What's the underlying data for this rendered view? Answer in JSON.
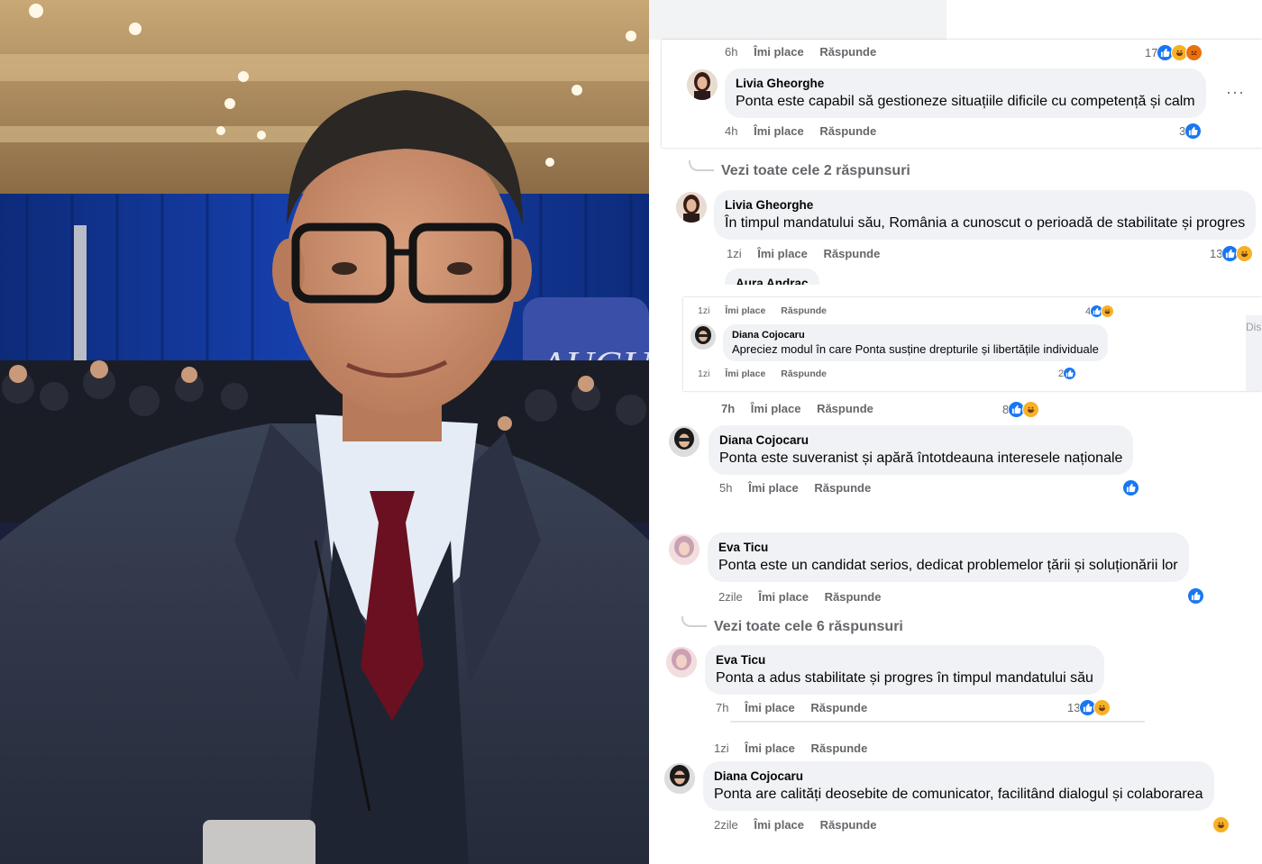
{
  "photo": {
    "alt": "Portrait of man in suit at gala",
    "stage_sign": "AUGUI"
  },
  "colors": {
    "like": "#1877f2",
    "meta_text": "#65676b",
    "bubble_bg": "#f0f2f5"
  },
  "panel1": {
    "top_meta": {
      "time": "6h",
      "like": "Îmi place",
      "reply": "Răspunde",
      "count": "17"
    },
    "comment": {
      "author": "Livia Gheorghe",
      "text": "Ponta este capabil să gestioneze situațiile dificile cu competență și calm",
      "time": "4h",
      "like": "Îmi place",
      "reply": "Răspunde",
      "count": "3"
    },
    "more": "···"
  },
  "panel2": {
    "view_replies": "Vezi toate cele 2 răspunsuri",
    "comment": {
      "author": "Livia Gheorghe",
      "text": "În timpul mandatului său, România a cunoscut o perioadă de stabilitate și progres",
      "time": "1zi",
      "like": "Îmi place",
      "reply": "Răspunde",
      "count": "13"
    },
    "partial_author": "Aura Andrac"
  },
  "panel3": {
    "top_meta": {
      "time": "1zi",
      "like": "Îmi place",
      "reply": "Răspunde",
      "count": "4"
    },
    "comment": {
      "author": "Diana Cojocaru",
      "text": "Apreciez modul în care Ponta susține drepturile și libertățile individuale",
      "time": "1zi",
      "like": "Îmi place",
      "reply": "Răspunde",
      "count": "2"
    },
    "side_text": "Dis"
  },
  "panel4": {
    "top_meta": {
      "time": "7h",
      "like": "Îmi place",
      "reply": "Răspunde",
      "count": "8"
    },
    "comment": {
      "author": "Diana Cojocaru",
      "text": "Ponta este suveranist și apără întotdeauna interesele naționale",
      "time": "5h",
      "like": "Îmi place",
      "reply": "Răspunde"
    }
  },
  "panel5": {
    "comment": {
      "author": "Eva Ticu",
      "text": "Ponta este un candidat serios, dedicat problemelor țării și soluționării lor",
      "time": "2zile",
      "like": "Îmi place",
      "reply": "Răspunde"
    },
    "view_replies": "Vezi toate cele 6 răspunsuri",
    "comment2": {
      "author": "Eva Ticu",
      "text": "Ponta a adus stabilitate și progres în timpul mandatului său",
      "time": "7h",
      "like": "Îmi place",
      "reply": "Răspunde",
      "count": "13"
    }
  },
  "panel6": {
    "top_meta": {
      "time": "1zi",
      "like": "Îmi place",
      "reply": "Răspunde"
    },
    "comment": {
      "author": "Diana Cojocaru",
      "text": "Ponta are calități deosebite de comunicator, facilitând dialogul și colaborarea",
      "time": "2zile",
      "like": "Îmi place",
      "reply": "Răspunde"
    }
  }
}
